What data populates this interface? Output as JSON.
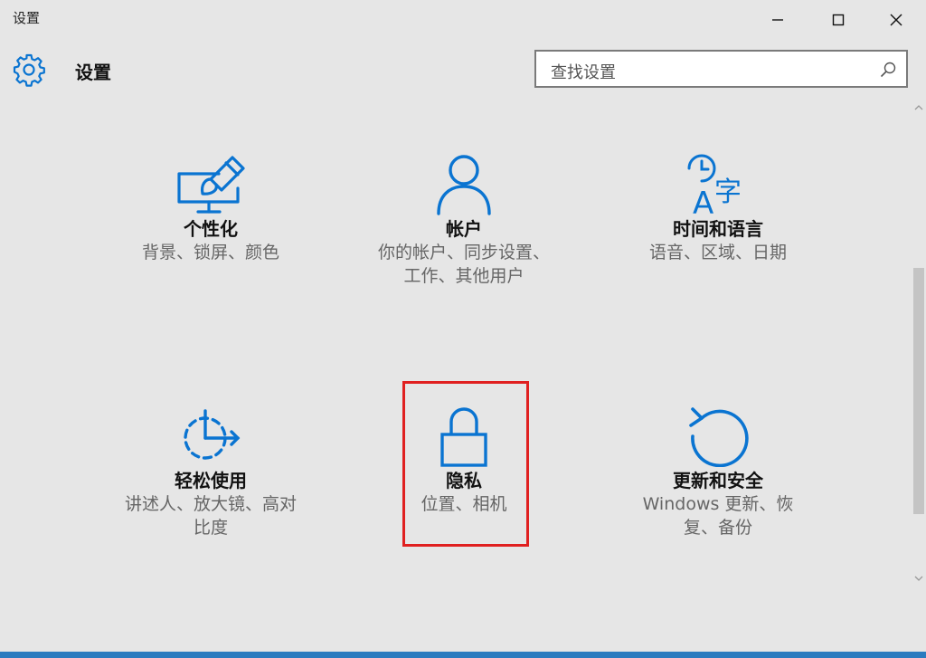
{
  "window": {
    "title": "设置",
    "buttons": [
      "minimize",
      "maximize",
      "close"
    ]
  },
  "header": {
    "title": "设置",
    "icon": "gear-icon"
  },
  "search": {
    "placeholder": "查找设置",
    "icon": "search-icon"
  },
  "tiles": [
    {
      "id": "personalization",
      "icon": "personalization-icon",
      "name": "个性化",
      "desc": [
        "背景、锁屏、颜色"
      ]
    },
    {
      "id": "accounts",
      "icon": "account-icon",
      "name": "帐户",
      "desc": [
        "你的帐户、同步设置、",
        "工作、其他用户"
      ]
    },
    {
      "id": "time-language",
      "icon": "time-language-icon",
      "name": "时间和语言",
      "desc": [
        "语音、区域、日期"
      ]
    },
    {
      "id": "ease-of-access",
      "icon": "ease-of-access-icon",
      "name": "轻松使用",
      "desc": [
        "讲述人、放大镜、高对",
        "比度"
      ]
    },
    {
      "id": "privacy",
      "icon": "lock-icon",
      "name": "隐私",
      "desc": [
        "位置、相机"
      ],
      "highlighted": true
    },
    {
      "id": "update-security",
      "icon": "update-icon",
      "name": "更新和安全",
      "desc": [
        "Windows 更新、恢",
        "复、备份"
      ]
    }
  ],
  "colors": {
    "accent": "#0a74d1",
    "background": "#e6e6e6",
    "highlight_border": "#e02020"
  }
}
